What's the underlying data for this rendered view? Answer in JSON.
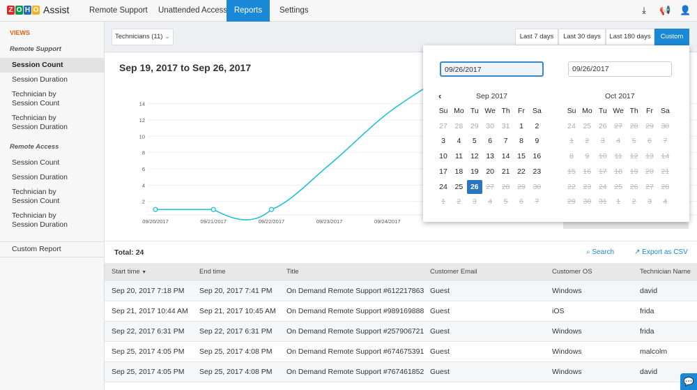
{
  "header": {
    "logo_letters": [
      "Z",
      "O",
      "H",
      "O"
    ],
    "logo_colors": [
      "#e42527",
      "#089949",
      "#226db4",
      "#f9b21d"
    ],
    "brand": "Assist",
    "nav": [
      {
        "label": "Remote Support",
        "active": false
      },
      {
        "label": "Unattended Access",
        "active": false
      },
      {
        "label": "Reports",
        "active": true
      },
      {
        "label": "Settings",
        "active": false
      }
    ],
    "icons": [
      "download-icon",
      "megaphone-icon",
      "user-icon"
    ]
  },
  "sidebar": {
    "views_label": "VIEWS",
    "groups": [
      {
        "label": "Remote Support",
        "items": [
          "Session Count",
          "Session Duration",
          "Technician by Session Count",
          "Technician by Session Duration"
        ]
      },
      {
        "label": "Remote Access",
        "items": [
          "Session Count",
          "Session Duration",
          "Technician by Session Count",
          "Technician by Session Duration"
        ]
      }
    ],
    "selected": "Remote Support / Session Count",
    "custom_report": "Custom Report"
  },
  "filter": {
    "technicians": "Technicians (11)",
    "ranges": [
      "Last 7 days",
      "Last 30 days",
      "Last 180 days",
      "Custom"
    ],
    "active_range": "Custom"
  },
  "range_title": "Sep 19, 2017 to Sep 26, 2017",
  "datepicker": {
    "from": "09/26/2017",
    "to": "09/26/2017",
    "weekdays": [
      "Su",
      "Mo",
      "Tu",
      "We",
      "Th",
      "Fr",
      "Sa"
    ],
    "months": [
      {
        "title": "Sep 2017",
        "days": [
          [
            "27",
            "o"
          ],
          [
            "28",
            "o"
          ],
          [
            "29",
            "o"
          ],
          [
            "30",
            "o"
          ],
          [
            "31",
            "o"
          ],
          [
            "1",
            "n"
          ],
          [
            "2",
            "n"
          ],
          [
            "3",
            "n"
          ],
          [
            "4",
            "n"
          ],
          [
            "5",
            "n"
          ],
          [
            "6",
            "n"
          ],
          [
            "7",
            "n"
          ],
          [
            "8",
            "n"
          ],
          [
            "9",
            "n"
          ],
          [
            "10",
            "n"
          ],
          [
            "11",
            "n"
          ],
          [
            "12",
            "n"
          ],
          [
            "13",
            "n"
          ],
          [
            "14",
            "n"
          ],
          [
            "15",
            "n"
          ],
          [
            "16",
            "n"
          ],
          [
            "17",
            "n"
          ],
          [
            "18",
            "n"
          ],
          [
            "19",
            "n"
          ],
          [
            "20",
            "n"
          ],
          [
            "21",
            "n"
          ],
          [
            "22",
            "n"
          ],
          [
            "23",
            "n"
          ],
          [
            "24",
            "n"
          ],
          [
            "25",
            "n"
          ],
          [
            "26",
            "sel"
          ],
          [
            "27",
            "d"
          ],
          [
            "28",
            "d"
          ],
          [
            "29",
            "d"
          ],
          [
            "30",
            "d"
          ],
          [
            "1",
            "d"
          ],
          [
            "2",
            "d"
          ],
          [
            "3",
            "d"
          ],
          [
            "4",
            "d"
          ],
          [
            "5",
            "d"
          ],
          [
            "6",
            "d"
          ],
          [
            "7",
            "d"
          ]
        ]
      },
      {
        "title": "Oct 2017",
        "days": [
          [
            "24",
            "o"
          ],
          [
            "25",
            "o"
          ],
          [
            "26",
            "o"
          ],
          [
            "27",
            "d"
          ],
          [
            "28",
            "d"
          ],
          [
            "29",
            "d"
          ],
          [
            "30",
            "d"
          ],
          [
            "1",
            "d"
          ],
          [
            "2",
            "d"
          ],
          [
            "3",
            "d"
          ],
          [
            "4",
            "d"
          ],
          [
            "5",
            "d"
          ],
          [
            "6",
            "d"
          ],
          [
            "7",
            "d"
          ],
          [
            "8",
            "d"
          ],
          [
            "9",
            "d"
          ],
          [
            "10",
            "d"
          ],
          [
            "11",
            "d"
          ],
          [
            "12",
            "d"
          ],
          [
            "13",
            "d"
          ],
          [
            "14",
            "d"
          ],
          [
            "15",
            "d"
          ],
          [
            "16",
            "d"
          ],
          [
            "17",
            "d"
          ],
          [
            "18",
            "d"
          ],
          [
            "19",
            "d"
          ],
          [
            "20",
            "d"
          ],
          [
            "21",
            "d"
          ],
          [
            "22",
            "d"
          ],
          [
            "23",
            "d"
          ],
          [
            "24",
            "d"
          ],
          [
            "25",
            "d"
          ],
          [
            "26",
            "d"
          ],
          [
            "27",
            "d"
          ],
          [
            "28",
            "d"
          ],
          [
            "29",
            "d"
          ],
          [
            "30",
            "d"
          ],
          [
            "31",
            "d"
          ],
          [
            "1",
            "d"
          ],
          [
            "2",
            "d"
          ],
          [
            "3",
            "d"
          ],
          [
            "4",
            "d"
          ]
        ]
      }
    ]
  },
  "chart_data": {
    "type": "line",
    "x": [
      "09/20/2017",
      "09/21/2017",
      "09/22/2017",
      "09/23/2017",
      "09/24/2017"
    ],
    "points": [
      {
        "x": "09/20/2017",
        "y": 1
      },
      {
        "x": "09/21/2017",
        "y": 1
      },
      {
        "x": "09/22/2017",
        "y": 1
      }
    ],
    "y_ticks": [
      2,
      4,
      6,
      8,
      10,
      12,
      14
    ],
    "ylim": [
      0,
      14
    ],
    "grid": true,
    "color": "#22c0d8",
    "smooth": true
  },
  "table": {
    "total": "Total: 24",
    "search": "Search",
    "export": "Export as CSV",
    "columns": [
      "Start time",
      "End time",
      "Title",
      "Customer Email",
      "Customer OS",
      "Technician Name"
    ],
    "rows": [
      [
        "Sep 20, 2017 7:18 PM",
        "Sep 20, 2017 7:41 PM",
        "On Demand Remote Support #612217863",
        "Guest",
        "Windows",
        "david"
      ],
      [
        "Sep 21, 2017 10:44 AM",
        "Sep 21, 2017 10:45 AM",
        "On Demand Remote Support #989169888",
        "Guest",
        "iOS",
        "frida"
      ],
      [
        "Sep 22, 2017 6:31 PM",
        "Sep 22, 2017 6:31 PM",
        "On Demand Remote Support #257906721",
        "Guest",
        "Windows",
        "frida"
      ],
      [
        "Sep 25, 2017 4:05 PM",
        "Sep 25, 2017 4:08 PM",
        "On Demand Remote Support #674675391",
        "Guest",
        "Windows",
        "malcolm"
      ],
      [
        "Sep 25, 2017 4:05 PM",
        "Sep 25, 2017 4:08 PM",
        "On Demand Remote Support #767461852",
        "Guest",
        "Windows",
        "david"
      ]
    ]
  }
}
